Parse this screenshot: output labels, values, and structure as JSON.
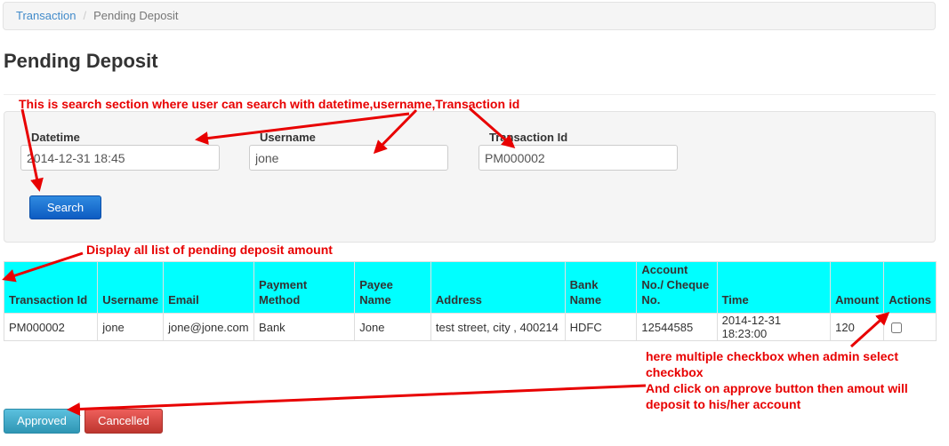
{
  "breadcrumb": {
    "items": [
      "Transaction",
      "Pending Deposit"
    ]
  },
  "page": {
    "title": "Pending Deposit"
  },
  "search": {
    "datetime_label": "Datetime",
    "datetime_value": "2014-12-31 18:45",
    "username_label": "Username",
    "username_value": "jone",
    "transaction_label": "Transaction Id",
    "transaction_value": "PM000002",
    "search_button": "Search"
  },
  "table": {
    "columns": [
      "Transaction Id",
      "Username",
      "Email",
      "Payment Method",
      "Payee Name",
      "Address",
      "Bank Name",
      "Account No./ Cheque No.",
      "Time",
      "Amount",
      "Actions"
    ],
    "rows": [
      [
        "PM000002",
        "jone",
        "jone@jone.com",
        "Bank",
        "Jone",
        "test street, city , 400214",
        "HDFC",
        "12544585",
        "2014-12-31 18:23:00",
        "120"
      ]
    ]
  },
  "actions": {
    "approve_label": "Approved",
    "cancel_label": "Cancelled"
  },
  "annotations": {
    "search_note": "This is search section where user can search with datetime,username,Transaction id",
    "list_note": "Display all list of pending deposit amount",
    "checkbox_note": "here multiple checkbox when admin select checkbox\nAnd click on approve button then amout will deposit to his/her account"
  },
  "colors": {
    "annotation": "#e80000",
    "table_header": "#00ffff",
    "search_button": "#1a6fd4",
    "approve_button": "#49afcd",
    "cancel_button": "#da4f49"
  }
}
